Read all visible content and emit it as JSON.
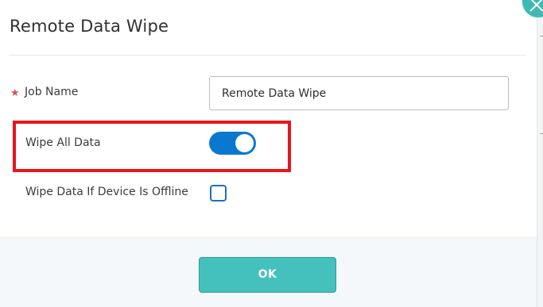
{
  "dialog": {
    "title": "Remote Data Wipe",
    "close_icon": "close-icon"
  },
  "form": {
    "job_name": {
      "required_marker": "★",
      "label": "Job Name",
      "value": "Remote Data Wipe"
    },
    "wipe_all_data": {
      "label": "Wipe All Data",
      "checked": true
    },
    "wipe_if_offline": {
      "label": "Wipe Data If Device Is Offline",
      "checked": false
    }
  },
  "footer": {
    "ok_label": "OK"
  },
  "colors": {
    "accent_teal": "#45c1bd",
    "toggle_on": "#0a78cf",
    "highlight_red": "#e8151c",
    "required_red": "#d9534f"
  }
}
